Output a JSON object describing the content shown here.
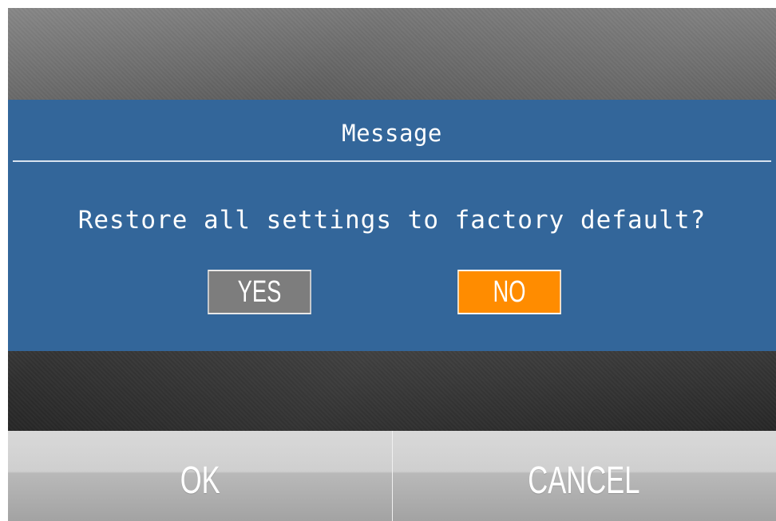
{
  "dialog": {
    "title": "Message",
    "message": "Restore all settings to factory default?",
    "yes_label": "YES",
    "no_label": "NO",
    "dialog_color": "#33669a",
    "selected_button": "NO",
    "selected_color": "#ff8c00",
    "unselected_color": "#7d7d7d"
  },
  "bottom_bar": {
    "ok_label": "OK",
    "cancel_label": "CANCEL"
  }
}
